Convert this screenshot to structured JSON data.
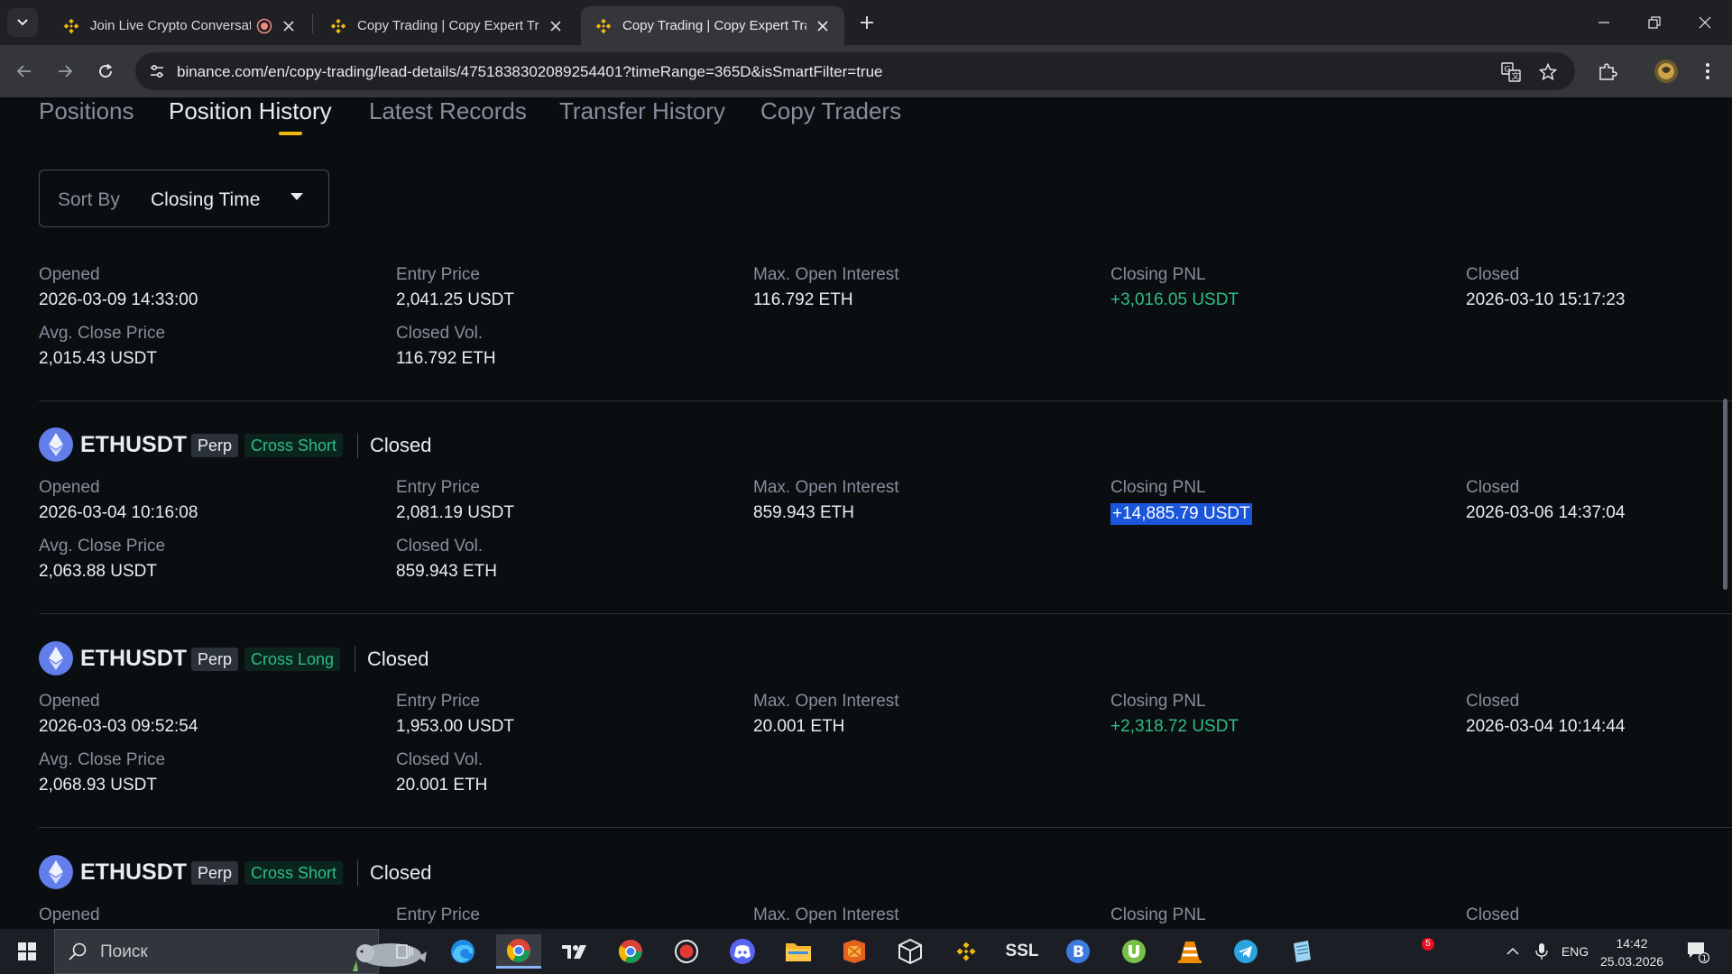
{
  "browser": {
    "tabs": [
      {
        "title": "Join Live Crypto Conversati",
        "recording": true
      },
      {
        "title": "Copy Trading | Copy Expert Tra"
      },
      {
        "title": "Copy Trading | Copy Expert Tra",
        "active": true
      }
    ],
    "url": "binance.com/en/copy-trading/lead-details/4751838302089254401?timeRange=365D&isSmartFilter=true"
  },
  "page": {
    "subtabs": [
      "Positions",
      "Position History",
      "Latest Records",
      "Transfer History",
      "Copy Traders"
    ],
    "active_subtab": "Position History",
    "sort": {
      "label": "Sort By",
      "value": "Closing Time"
    },
    "labels": {
      "opened": "Opened",
      "entry_price": "Entry Price",
      "max_open_interest": "Max. Open Interest",
      "closing_pnl": "Closing PNL",
      "closed": "Closed",
      "avg_close_price": "Avg. Close Price",
      "closed_vol": "Closed Vol."
    },
    "records": [
      {
        "opened": "2026-03-09 14:33:00",
        "entry_price": "2,041.25 USDT",
        "max_open_interest": "116.792 ETH",
        "closing_pnl": "+3,016.05 USDT",
        "closed": "2026-03-10 15:17:23",
        "avg_close_price": "2,015.43 USDT",
        "closed_vol": "116.792 ETH"
      },
      {
        "symbol": "ETHUSDT",
        "type": "Perp",
        "direction": "Cross Short",
        "status": "Closed",
        "opened": "2026-03-04 10:16:08",
        "entry_price": "2,081.19 USDT",
        "max_open_interest": "859.943 ETH",
        "closing_pnl": "+14,885.79 USDT",
        "closed": "2026-03-06 14:37:04",
        "avg_close_price": "2,063.88 USDT",
        "closed_vol": "859.943 ETH"
      },
      {
        "symbol": "ETHUSDT",
        "type": "Perp",
        "direction": "Cross Long",
        "status": "Closed",
        "opened": "2026-03-03 09:52:54",
        "entry_price": "1,953.00 USDT",
        "max_open_interest": "20.001 ETH",
        "closing_pnl": "+2,318.72 USDT",
        "closed": "2026-03-04 10:14:44",
        "avg_close_price": "2,068.93 USDT",
        "closed_vol": "20.001 ETH"
      },
      {
        "symbol": "ETHUSDT",
        "type": "Perp",
        "direction": "Cross Short",
        "status": "Closed"
      }
    ]
  },
  "taskbar": {
    "search_placeholder": "Поиск",
    "apps": [
      "task-view",
      "edge",
      "chrome-profile",
      "tradingview",
      "chrome",
      "recorder",
      "discord",
      "file-explorer",
      "office",
      "box",
      "binance",
      "ssl",
      "b-app",
      "utorrent",
      "vlc",
      "telegram",
      "notepad"
    ],
    "ssl_label": "SSL",
    "notification_count": "5",
    "lang": "ENG",
    "time": "14:42",
    "date": "25.03.2026",
    "action_center_count": "1"
  },
  "colors": {
    "accent": "#f0b90b",
    "positive": "#2ebd85",
    "background": "#0b0e11",
    "eth": "#627eea"
  }
}
